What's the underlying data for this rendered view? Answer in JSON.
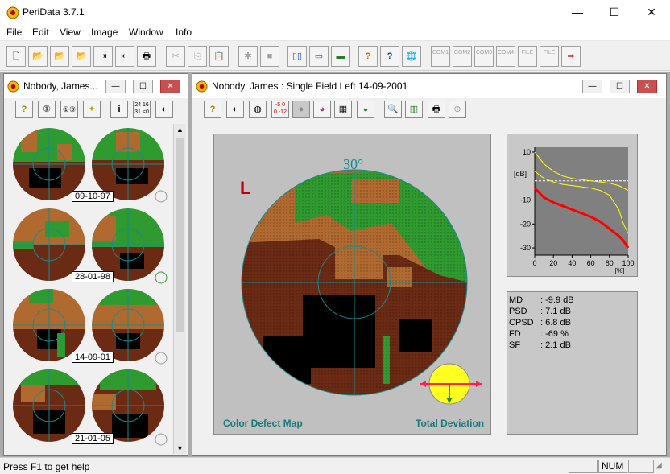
{
  "app": {
    "title": "PeriData 3.7.1",
    "window_controls": {
      "minimize": "—",
      "maximize": "☐",
      "close": "✕"
    }
  },
  "menu": [
    "File",
    "Edit",
    "View",
    "Image",
    "Window",
    "Info"
  ],
  "toolbar": {
    "buttons": [
      {
        "name": "new-icon",
        "glyph": "🗋"
      },
      {
        "name": "open-icon",
        "glyph": "📂"
      },
      {
        "name": "open-green-icon",
        "glyph": "📂"
      },
      {
        "name": "open-disabled-icon",
        "glyph": "📂"
      },
      {
        "name": "import-icon",
        "glyph": "⇥"
      },
      {
        "name": "export-icon",
        "glyph": "⇤"
      },
      {
        "name": "print-icon",
        "glyph": "🖶"
      },
      {
        "name": "cut-icon",
        "glyph": "✂"
      },
      {
        "name": "copy-icon",
        "glyph": "⎘"
      },
      {
        "name": "paste-icon",
        "glyph": "📋"
      },
      {
        "name": "bug-icon",
        "glyph": "✱"
      },
      {
        "name": "stop-icon",
        "glyph": "■"
      },
      {
        "name": "tile-vertical-icon",
        "glyph": "▯▯"
      },
      {
        "name": "tile-horizontal-icon",
        "glyph": "▭"
      },
      {
        "name": "monitor-icon",
        "glyph": "▬"
      },
      {
        "name": "help-icon",
        "glyph": "?"
      },
      {
        "name": "context-help-icon",
        "glyph": "?"
      },
      {
        "name": "web-icon",
        "glyph": "🌐"
      }
    ],
    "com_buttons": [
      "COM1",
      "COM2",
      "COM3",
      "COM4",
      "FILE",
      "FILE"
    ],
    "last_button": {
      "name": "key-icon",
      "glyph": "⇒"
    }
  },
  "left_window": {
    "title": "Nobody, James...",
    "tool_glyphs": [
      "?",
      "①",
      "①③",
      "✦",
      "i",
      "24 16\n31 <0",
      "◐"
    ],
    "dates": [
      "09-10-97",
      "28-01-98",
      "14-09-01",
      "21-01-05"
    ]
  },
  "right_window": {
    "title": "Nobody, James :  Single Field  Left  14-09-2001",
    "tool_glyphs": [
      "?",
      "◐",
      "◍",
      "-5 0\n0 -12",
      "●",
      "◕",
      "▦",
      "◒",
      "🔍",
      "▥",
      "🖶",
      "⊕"
    ],
    "eye_label": "L",
    "angle_label": "30°",
    "left_caption": "Color Defect Map",
    "right_caption": "Total Deviation"
  },
  "chart_data": {
    "type": "line",
    "x": [
      0,
      10,
      20,
      30,
      40,
      50,
      60,
      70,
      80,
      90,
      95,
      100
    ],
    "xlabel": "[%]",
    "ylabel": "[dB]",
    "xticks": [
      0,
      20,
      40,
      60,
      80,
      100
    ],
    "yticks": [
      10,
      -10,
      -20,
      -30
    ],
    "xlim": [
      0,
      100
    ],
    "ylim": [
      -33,
      12
    ],
    "series": [
      {
        "color": "#ffff00",
        "values": [
          10,
          5,
          2,
          0,
          -1,
          -1.5,
          -2,
          -2.5,
          -3,
          -4,
          -5,
          -6
        ]
      },
      {
        "color": "#ffff00",
        "values": [
          2,
          -1,
          -2.5,
          -3.5,
          -4,
          -4.5,
          -5,
          -6,
          -8,
          -14,
          -20,
          -24
        ]
      },
      {
        "color": "#ff0000",
        "values": [
          -5,
          -9,
          -11,
          -12.5,
          -14,
          -15.5,
          -17,
          -19,
          -22,
          -25,
          -27,
          -30
        ]
      }
    ],
    "reference": {
      "color": "#ffffff",
      "style": "dashed",
      "values": [
        -2,
        -2
      ]
    }
  },
  "stats": [
    {
      "label": "MD",
      "value": ": -9.9 dB"
    },
    {
      "label": "PSD",
      "value": ": 7.1 dB"
    },
    {
      "label": "CPSD",
      "value": ": 6.8 dB"
    },
    {
      "label": "FD",
      "value": ": -69 %"
    },
    {
      "label": "SF",
      "value": ": 2.1 dB"
    }
  ],
  "status": {
    "message": "Press F1 to get help",
    "num": "NUM"
  },
  "colors": {
    "healthy": "#2f9a2f",
    "mild": "#b06a30",
    "moderate": "#6a2a14",
    "severe": "#000000",
    "axis_cyan": "#1a8a8a",
    "caption_teal": "#1a7a7a"
  }
}
